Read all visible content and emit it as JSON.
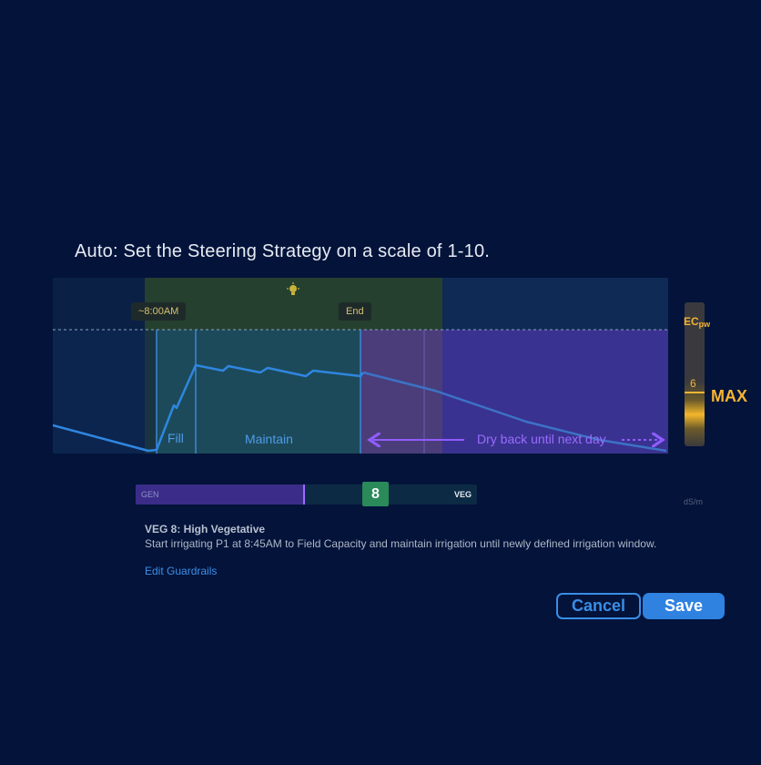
{
  "heading": "Auto: Set the Steering Strategy on a scale of 1-10.",
  "chart": {
    "start_chip": "~8:00AM",
    "end_chip": "End",
    "phases": [
      "Fill",
      "Maintain",
      "Dry back until next day"
    ],
    "ec": {
      "label": "EC",
      "label_sub": "pw",
      "value": "6",
      "max": "MAX",
      "unit": "dS/m"
    },
    "colors": {
      "line": "#2f86e0",
      "purple": "#8f5cff",
      "ec": "#f5b431"
    }
  },
  "slider": {
    "left_label": "GEN",
    "right_label": "VEG",
    "value": "8"
  },
  "description": {
    "title": "VEG 8: High Vegetative",
    "text": "Start irrigating P1 at 8:45AM to Field Capacity and maintain irrigation until newly defined irrigation window."
  },
  "links": {
    "edit_guardrails": "Edit Guardrails"
  },
  "buttons": {
    "cancel": "Cancel",
    "save": "Save"
  }
}
